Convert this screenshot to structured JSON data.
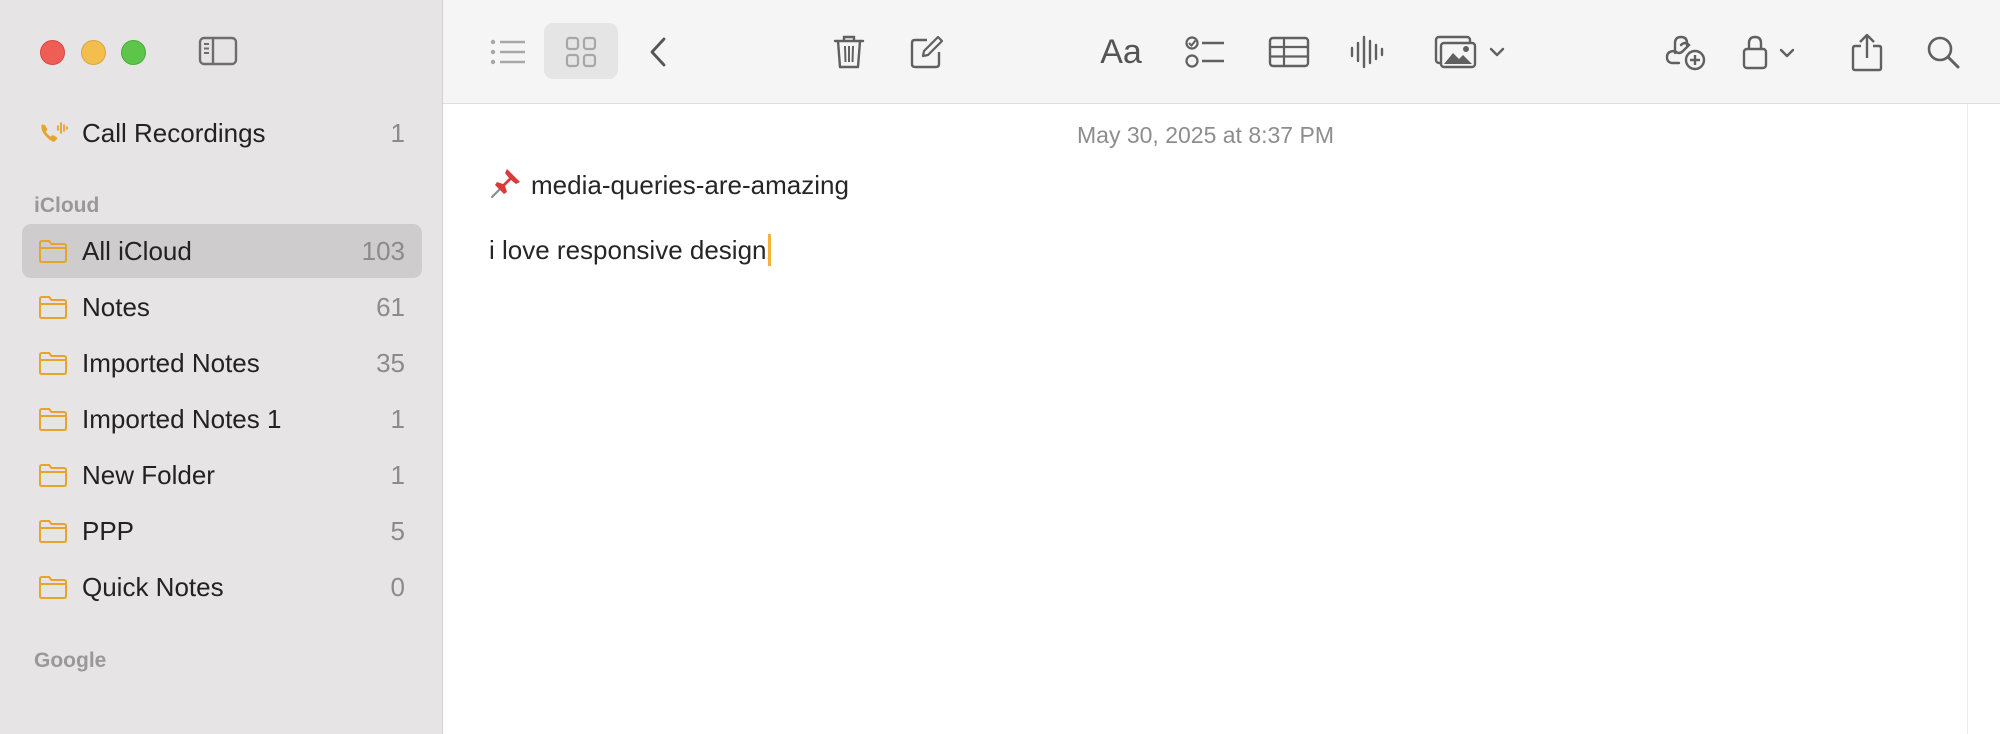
{
  "window": {
    "controls": {
      "close": "close",
      "minimize": "minimize",
      "maximize": "maximize"
    }
  },
  "sidebar": {
    "top_items": [
      {
        "label": "Call Recordings",
        "count": "1",
        "icon": "phone-waveform-icon"
      }
    ],
    "sections": [
      {
        "header": "iCloud",
        "items": [
          {
            "label": "All iCloud",
            "count": "103",
            "icon": "folder-icon",
            "selected": true
          },
          {
            "label": "Notes",
            "count": "61",
            "icon": "folder-icon"
          },
          {
            "label": "Imported Notes",
            "count": "35",
            "icon": "folder-icon"
          },
          {
            "label": "Imported Notes 1",
            "count": "1",
            "icon": "folder-icon"
          },
          {
            "label": "New Folder",
            "count": "1",
            "icon": "folder-icon"
          },
          {
            "label": "PPP",
            "count": "5",
            "icon": "folder-icon"
          },
          {
            "label": "Quick Notes",
            "count": "0",
            "icon": "folder-icon"
          }
        ]
      },
      {
        "header": "Google",
        "items": []
      }
    ]
  },
  "toolbar": {
    "buttons": [
      "list-view-icon",
      "gallery-view-icon",
      "back-icon",
      "trash-icon",
      "compose-icon",
      "format-text-icon",
      "checklist-icon",
      "table-icon",
      "audio-waveform-icon",
      "media-icon",
      "collaborate-icon",
      "lock-icon",
      "share-icon",
      "search-icon"
    ],
    "format_label": "Aa"
  },
  "note": {
    "date": "May 30, 2025 at 8:37 PM",
    "title": "media-queries-are-amazing",
    "body": "i love responsive design"
  },
  "colors": {
    "accent": "#f0b53a",
    "folder_icon": "#e7a42a",
    "sidebar_bg": "#e6e4e4",
    "selected_row": "#cecccc"
  }
}
